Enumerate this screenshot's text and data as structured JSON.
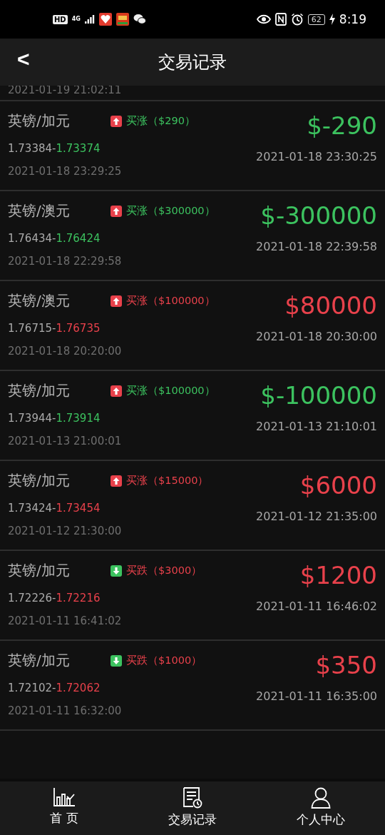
{
  "status_bar": {
    "hd": "HD",
    "network": "4G",
    "battery": "62",
    "time": "8:19"
  },
  "header": {
    "back": "<",
    "title": "交易记录"
  },
  "partial_row": {
    "open_time": "2021-01-19 21:02:11"
  },
  "records": [
    {
      "pair": "英镑/加元",
      "kind": "up",
      "order": "买涨（$290）",
      "open_price": "1.73384-",
      "close_price": "1.73374",
      "open_time": "2021-01-18 23:29:25",
      "profit": "$-290",
      "close_time": "2021-01-18 23:30:25",
      "color": "#3cc25f"
    },
    {
      "pair": "英镑/澳元",
      "kind": "up",
      "order": "买涨（$300000）",
      "open_price": "1.76434-",
      "close_price": "1.76424",
      "open_time": "2021-01-18 22:29:58",
      "profit": "$-300000",
      "close_time": "2021-01-18 22:39:58",
      "color": "#3cc25f"
    },
    {
      "pair": "英镑/澳元",
      "kind": "up",
      "order": "买涨（$100000）",
      "open_price": "1.76715-",
      "close_price": "1.76735",
      "open_time": "2021-01-18 20:20:00",
      "profit": "$80000",
      "close_time": "2021-01-18 20:30:00",
      "color": "#e8414b"
    },
    {
      "pair": "英镑/加元",
      "kind": "up",
      "order": "买涨（$100000）",
      "open_price": "1.73944-",
      "close_price": "1.73914",
      "open_time": "2021-01-13 21:00:01",
      "profit": "$-100000",
      "close_time": "2021-01-13 21:10:01",
      "color": "#3cc25f"
    },
    {
      "pair": "英镑/加元",
      "kind": "up",
      "order": "买涨（$15000）",
      "open_price": "1.73424-",
      "close_price": "1.73454",
      "open_time": "2021-01-12 21:30:00",
      "profit": "$6000",
      "close_time": "2021-01-12 21:35:00",
      "color": "#e8414b"
    },
    {
      "pair": "英镑/加元",
      "kind": "down",
      "order": "买跌（$3000）",
      "open_price": "1.72226-",
      "close_price": "1.72216",
      "open_time": "2021-01-11 16:41:02",
      "profit": "$1200",
      "close_time": "2021-01-11 16:46:02",
      "color": "#e8414b"
    },
    {
      "pair": "英镑/加元",
      "kind": "down",
      "order": "买跌（$1000）",
      "open_price": "1.72102-",
      "close_price": "1.72062",
      "open_time": "2021-01-11 16:32:00",
      "profit": "$350",
      "close_time": "2021-01-11 16:35:00",
      "color": "#e8414b"
    }
  ],
  "bottom_nav": [
    {
      "kind": "chart",
      "label": "首 页"
    },
    {
      "kind": "document",
      "label": "交易记录"
    },
    {
      "kind": "person",
      "label": "个人中心"
    }
  ]
}
